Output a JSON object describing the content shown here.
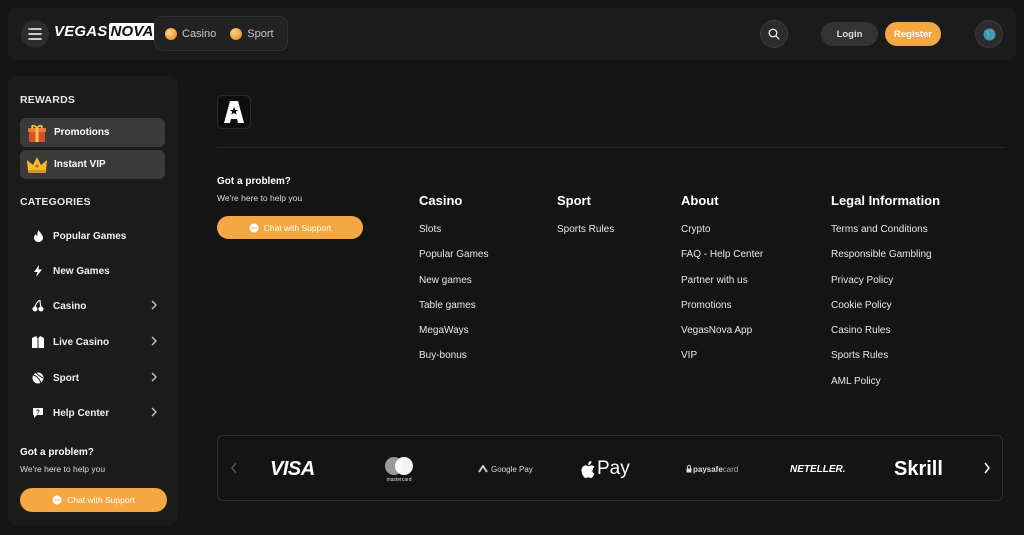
{
  "header": {
    "logo_part1": "VEGAS",
    "logo_part2": "NOVA",
    "tabs": [
      {
        "label": "Casino"
      },
      {
        "label": "Sport"
      }
    ],
    "login_label": "Login",
    "register_label": "Register"
  },
  "sidebar": {
    "rewards_title": "REWARDS",
    "rewards": [
      {
        "label": "Promotions",
        "icon": "gift-box-icon"
      },
      {
        "label": "Instant VIP",
        "icon": "crown-icon"
      }
    ],
    "categories_title": "CATEGORIES",
    "categories": [
      {
        "label": "Popular Games",
        "icon": "flame-icon",
        "has_chevron": false
      },
      {
        "label": "New Games",
        "icon": "lightning-icon",
        "has_chevron": false
      },
      {
        "label": "Casino",
        "icon": "cherry-icon",
        "has_chevron": true
      },
      {
        "label": "Live Casino",
        "icon": "dealer-icon",
        "has_chevron": true
      },
      {
        "label": "Sport",
        "icon": "ball-icon",
        "has_chevron": true
      },
      {
        "label": "Help Center",
        "icon": "help-chat-icon",
        "has_chevron": true
      }
    ],
    "problem_title": "Got a problem?",
    "problem_sub": "We're here to help you",
    "chat_label": "Chat with Support"
  },
  "main": {
    "problem_title": "Got a problem?",
    "problem_sub": "We're here to help you",
    "chat_label": "Chat with Support",
    "columns": [
      {
        "title": "Casino",
        "links": [
          "Slots",
          "Popular Games",
          "New games",
          "Table games",
          "MegaWays",
          "Buy-bonus"
        ]
      },
      {
        "title": "Sport",
        "links": [
          "Sports Rules"
        ]
      },
      {
        "title": "About",
        "links": [
          "Crypto",
          "FAQ - Help Center",
          "Partner with us",
          "Promotions",
          "VegasNova App",
          "VIP"
        ]
      },
      {
        "title": "Legal Information",
        "links": [
          "Terms and Conditions",
          "Responsible Gambling",
          "Privacy Policy",
          "Cookie Policy",
          "Casino Rules",
          "Sports Rules",
          "AML Policy"
        ]
      }
    ]
  },
  "payments": {
    "visa": "VISA",
    "mastercard": "mastercard",
    "google_pay": "Google Pay",
    "apple_pay": "Pay",
    "paysafecard_a": "paysafe",
    "paysafecard_b": "card",
    "neteller": "NETELLER.",
    "skrill": "Skrill"
  },
  "colors": {
    "accent": "#f4a742",
    "background": "#141414",
    "panel": "#1b1b1b"
  }
}
